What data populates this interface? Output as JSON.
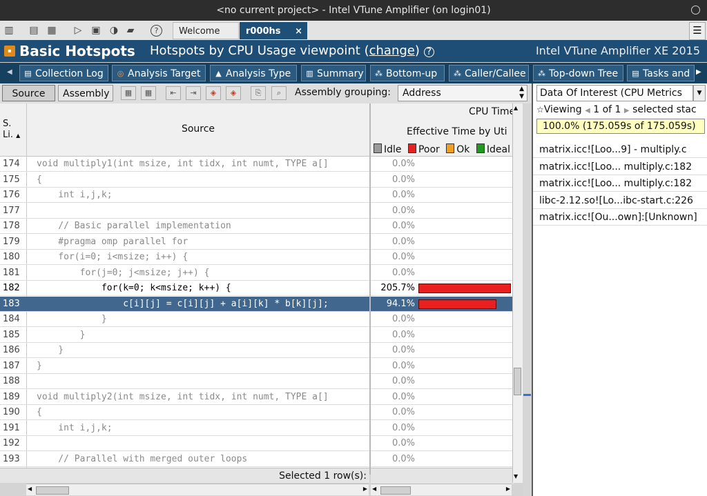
{
  "window": {
    "title": "<no current project> - Intel VTune Amplifier (on login01)"
  },
  "tabs": {
    "welcome": "Welcome",
    "result": "r000hs",
    "close": "×"
  },
  "header": {
    "title": "Basic Hotspots",
    "viewpoint_prefix": "Hotspots by CPU Usage viewpoint (",
    "viewpoint_link": "change",
    "viewpoint_suffix": ")",
    "help": "?",
    "brand": "Intel VTune Amplifier XE 2015"
  },
  "analysis_tabs": [
    "Collection Log",
    "Analysis Target",
    "Analysis Type",
    "Summary",
    "Bottom-up",
    "Caller/Callee",
    "Top-down Tree",
    "Tasks and"
  ],
  "source_toolbar": {
    "source": "Source",
    "assembly": "Assembly",
    "grouping_label": "Assembly grouping:",
    "grouping_value": "Address"
  },
  "grid": {
    "col_line_1": "S.",
    "col_line_2": "Li.",
    "col_source": "Source",
    "cpu_time": "CPU Time",
    "effective_time": "Effective Time by Uti",
    "legend": {
      "idle": "Idle",
      "poor": "Poor",
      "ok": "Ok",
      "ideal": "Ideal"
    },
    "legend_colors": {
      "idle": "#9a9a9a",
      "poor": "#e82020",
      "ok": "#f0a020",
      "ideal": "#1f9a1f"
    },
    "rows": [
      {
        "line": "174",
        "code": "void multiply1(int msize, int tidx, int numt, TYPE a[]",
        "pct": "0.0%",
        "fill": 0
      },
      {
        "line": "175",
        "code": "{",
        "pct": "0.0%",
        "fill": 0
      },
      {
        "line": "176",
        "code": "    int i,j,k;",
        "pct": "0.0%",
        "fill": 0
      },
      {
        "line": "177",
        "code": "",
        "pct": "0.0%",
        "fill": 0
      },
      {
        "line": "178",
        "code": "    // Basic parallel implementation",
        "pct": "0.0%",
        "fill": 0
      },
      {
        "line": "179",
        "code": "    #pragma omp parallel for",
        "pct": "0.0%",
        "fill": 0
      },
      {
        "line": "180",
        "code": "    for(i=0; i<msize; i++) {",
        "pct": "0.0%",
        "fill": 0
      },
      {
        "line": "181",
        "code": "        for(j=0; j<msize; j++) {",
        "pct": "0.0%",
        "fill": 0
      },
      {
        "line": "182",
        "code": "            for(k=0; k<msize; k++) {",
        "pct": "205.7%",
        "fill": 2.057
      },
      {
        "line": "183",
        "code": "                c[i][j] = c[i][j] + a[i][k] * b[k][j];",
        "pct": "94.1%",
        "fill": 0.941
      },
      {
        "line": "184",
        "code": "            }",
        "pct": "0.0%",
        "fill": 0
      },
      {
        "line": "185",
        "code": "        }",
        "pct": "0.0%",
        "fill": 0
      },
      {
        "line": "186",
        "code": "    }",
        "pct": "0.0%",
        "fill": 0
      },
      {
        "line": "187",
        "code": "}",
        "pct": "0.0%",
        "fill": 0
      },
      {
        "line": "188",
        "code": "",
        "pct": "0.0%",
        "fill": 0
      },
      {
        "line": "189",
        "code": "void multiply2(int msize, int tidx, int numt, TYPE a[]",
        "pct": "0.0%",
        "fill": 0
      },
      {
        "line": "190",
        "code": "{",
        "pct": "0.0%",
        "fill": 0
      },
      {
        "line": "191",
        "code": "    int i,j,k;",
        "pct": "0.0%",
        "fill": 0
      },
      {
        "line": "192",
        "code": "",
        "pct": "0.0%",
        "fill": 0
      },
      {
        "line": "193",
        "code": "    // Parallel with merged outer loops",
        "pct": "0.0%",
        "fill": 0
      }
    ],
    "selected_row": "183",
    "hot_rows": [
      "182",
      "183"
    ],
    "status": "Selected 1 row(s):"
  },
  "right_panel": {
    "data_of_interest": "Data Of Interest (CPU Metrics",
    "viewing": "Viewing",
    "page": "1 of 1",
    "selected": "selected stac",
    "percent": "100.0% (175.059s of 175.059s)",
    "stack": [
      "matrix.icc![Loo...9] - multiply.c",
      "matrix.icc![Loo... multiply.c:182",
      "matrix.icc![Loo... multiply.c:182",
      "libc-2.12.so![Lo...ibc-start.c:226",
      "matrix.icc![Ou...own]:[Unknown]"
    ]
  }
}
